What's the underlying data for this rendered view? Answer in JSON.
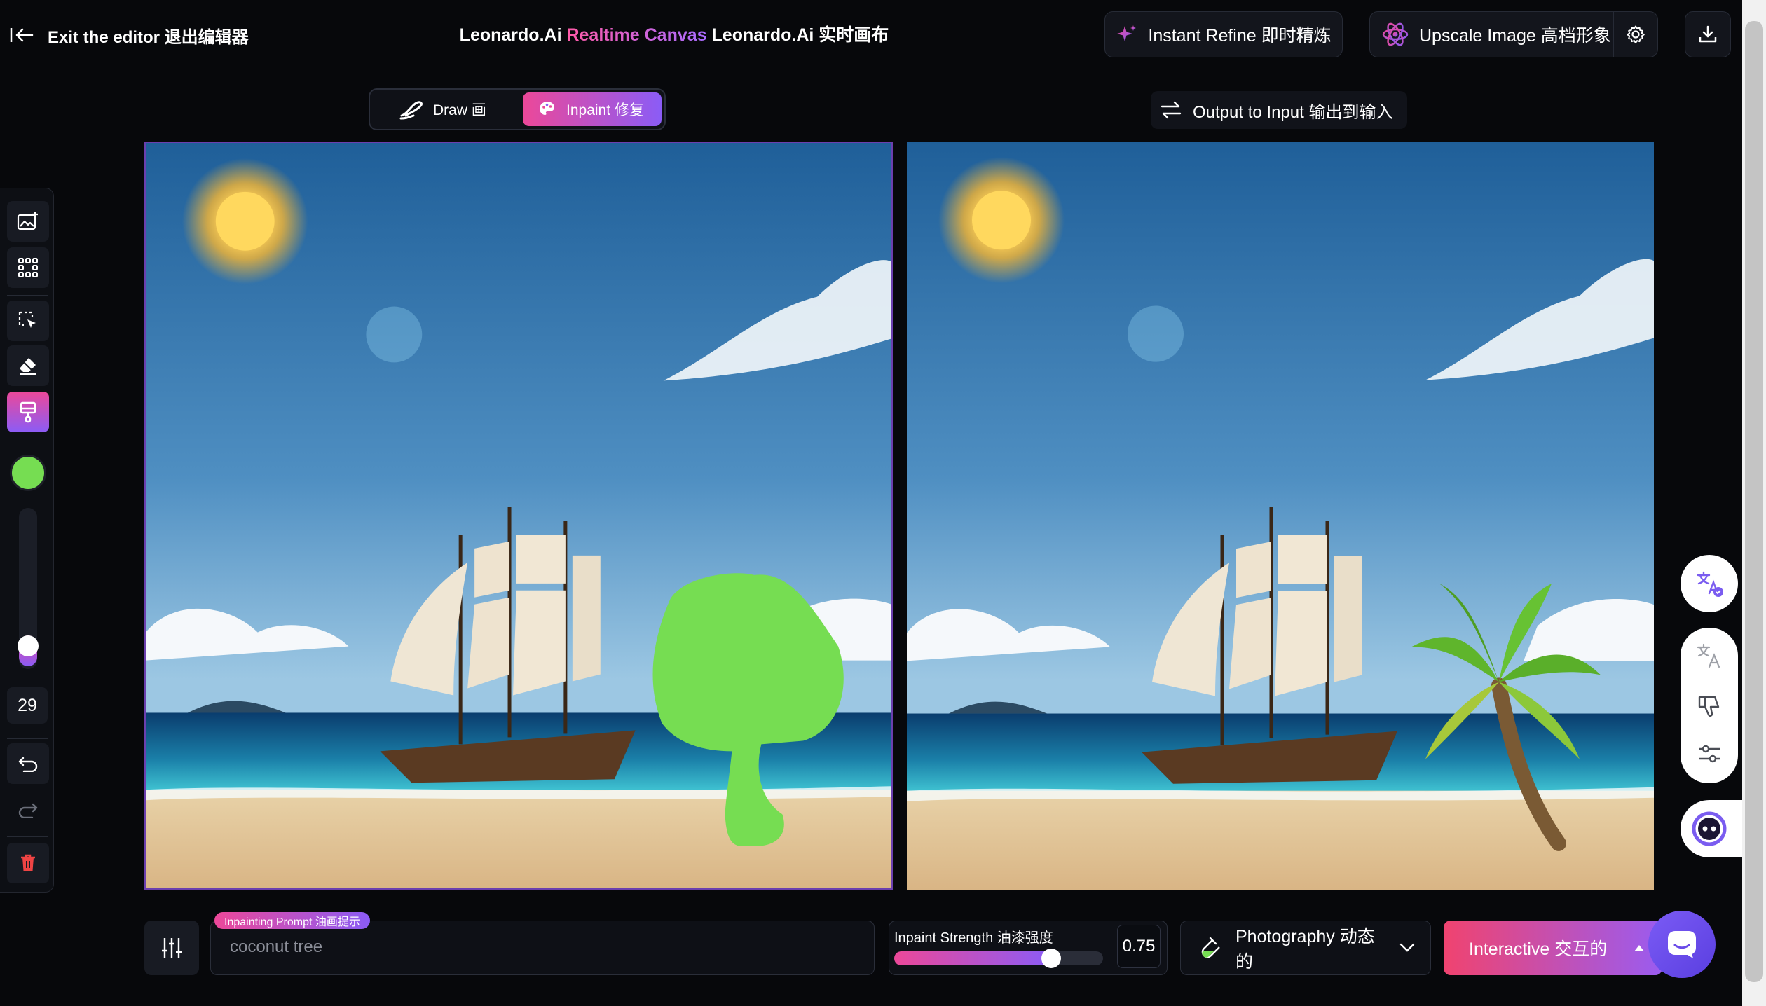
{
  "topbar": {
    "exit_label": "Exit the editor  退出编辑器",
    "title_prefix": "Leonardo.Ai ",
    "title_accent": "Realtime Canvas",
    "title_suffix": " Leonardo.Ai 实时画布",
    "refine_label": "Instant Refine 即时精炼",
    "upscale_label": "Upscale Image 高档形象"
  },
  "modes": {
    "draw_label": "Draw 画",
    "inpaint_label": "Inpaint 修复",
    "active": "inpaint"
  },
  "output_to_input_label": "Output to Input 输出到输入",
  "toolbar": {
    "active_tool": "paintbrush",
    "brush_color": "#76dd52",
    "brush_size": "29"
  },
  "prompt": {
    "tag": "Inpainting Prompt 油画提示",
    "value": "coconut tree"
  },
  "strength": {
    "label": "Inpaint Strength 油漆强度",
    "value": "0.75",
    "fraction": 0.75
  },
  "style": {
    "label": "Photography 动态的"
  },
  "generate": {
    "label": "Interactive 交互的"
  },
  "colors": {
    "accent_pink": "#ec4899",
    "accent_purple": "#8b5cf6",
    "background": "#07080b"
  }
}
